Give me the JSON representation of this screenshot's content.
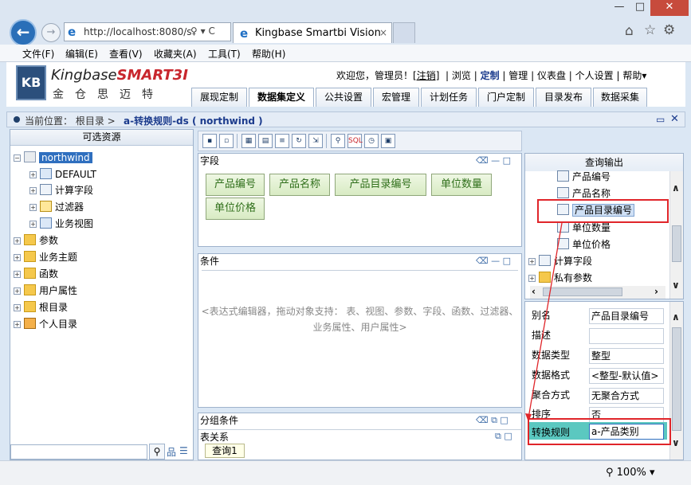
{
  "browser": {
    "window_controls": {
      "minimize": "—",
      "maximize": "□",
      "close": "✕"
    },
    "address": "http://localhost:8080/s",
    "address_tools": "♀ ▾ C",
    "tab_title": "Kingbase Smartbi Vision",
    "tab_close": "×",
    "menu": [
      "文件(F)",
      "编辑(E)",
      "查看(V)",
      "收藏夹(A)",
      "工具(T)",
      "帮助(H)"
    ],
    "zoom": "100%"
  },
  "header": {
    "logo_name_prefix": "Kingbase",
    "logo_name_brand": "SMART3I",
    "logo_cn": "金仓思迈特",
    "welcome": "欢迎您，管理员！",
    "logout": "[注销]",
    "links": [
      "浏览",
      "定制",
      "管理",
      "仪表盘",
      "个人设置",
      "帮助▾"
    ],
    "tabs": [
      "展现定制",
      "数据集定义",
      "公共设置",
      "宏管理",
      "计划任务",
      "门户定制",
      "目录发布",
      "数据采集"
    ]
  },
  "breadcrumb": {
    "label": "当前位置： 根目录 >",
    "title": "a-转换规则-ds ( northwind )"
  },
  "left_panel": {
    "title": "可选资源",
    "tree": [
      {
        "label": "northwind",
        "level": 0,
        "expander": "⊟",
        "icon": "database"
      },
      {
        "label": "DEFAULT",
        "level": 1,
        "expander": "⊞",
        "icon": "table"
      },
      {
        "label": "计算字段",
        "level": 1,
        "expander": "⊞",
        "icon": "field"
      },
      {
        "label": "过滤器",
        "level": 1,
        "expander": "⊞",
        "icon": "filter"
      },
      {
        "label": "业务视图",
        "level": 1,
        "expander": "⊞",
        "icon": "table"
      },
      {
        "label": "参数",
        "level": 0,
        "expander": "⊞",
        "icon": "folder"
      },
      {
        "label": "业务主题",
        "level": 0,
        "expander": "⊞",
        "icon": "folder"
      },
      {
        "label": "函数",
        "level": 0,
        "expander": "⊞",
        "icon": "folder"
      },
      {
        "label": "用户属性",
        "level": 0,
        "expander": "⊞",
        "icon": "folder"
      },
      {
        "label": "根目录",
        "level": 0,
        "expander": "⊞",
        "icon": "folder"
      },
      {
        "label": "个人目录",
        "level": 0,
        "expander": "⊞",
        "icon": "user"
      }
    ],
    "search_value": ""
  },
  "middle": {
    "fields_title": "字段",
    "fields": [
      "产品编号",
      "产品名称",
      "产品目录编号",
      "单位数量",
      "单位价格"
    ],
    "conditions_title": "条件",
    "conditions_hint_line1": "<表达式编辑器，拖动对象支持： 表、视图、参数、字段、函数、过滤器、",
    "conditions_hint_line2": "业务属性、用户属性>",
    "group_title": "分组条件",
    "relation_title": "表关系",
    "query_tab": "查询1"
  },
  "right_panel": {
    "title": "查询输出",
    "outputs": [
      "产品编号",
      "产品名称",
      "产品目录编号",
      "单位数量",
      "单位价格"
    ],
    "selected_output": "产品目录编号",
    "groups": [
      "计算字段",
      "私有参数"
    ],
    "properties": [
      {
        "label": "别名",
        "value": "产品目录编号"
      },
      {
        "label": "描述",
        "value": ""
      },
      {
        "label": "数据类型",
        "value": "整型"
      },
      {
        "label": "数据格式",
        "value": "<整型-默认值>"
      },
      {
        "label": "聚合方式",
        "value": "无聚合方式"
      },
      {
        "label": "排序",
        "value": "否"
      },
      {
        "label": "转换规则",
        "value": "a-产品类别"
      }
    ]
  },
  "colors": {
    "accent": "#2f6fbf",
    "annotation": "#e0252a",
    "field_chip": "#d8ebc3",
    "highlight_row": "#5bc8c0"
  }
}
